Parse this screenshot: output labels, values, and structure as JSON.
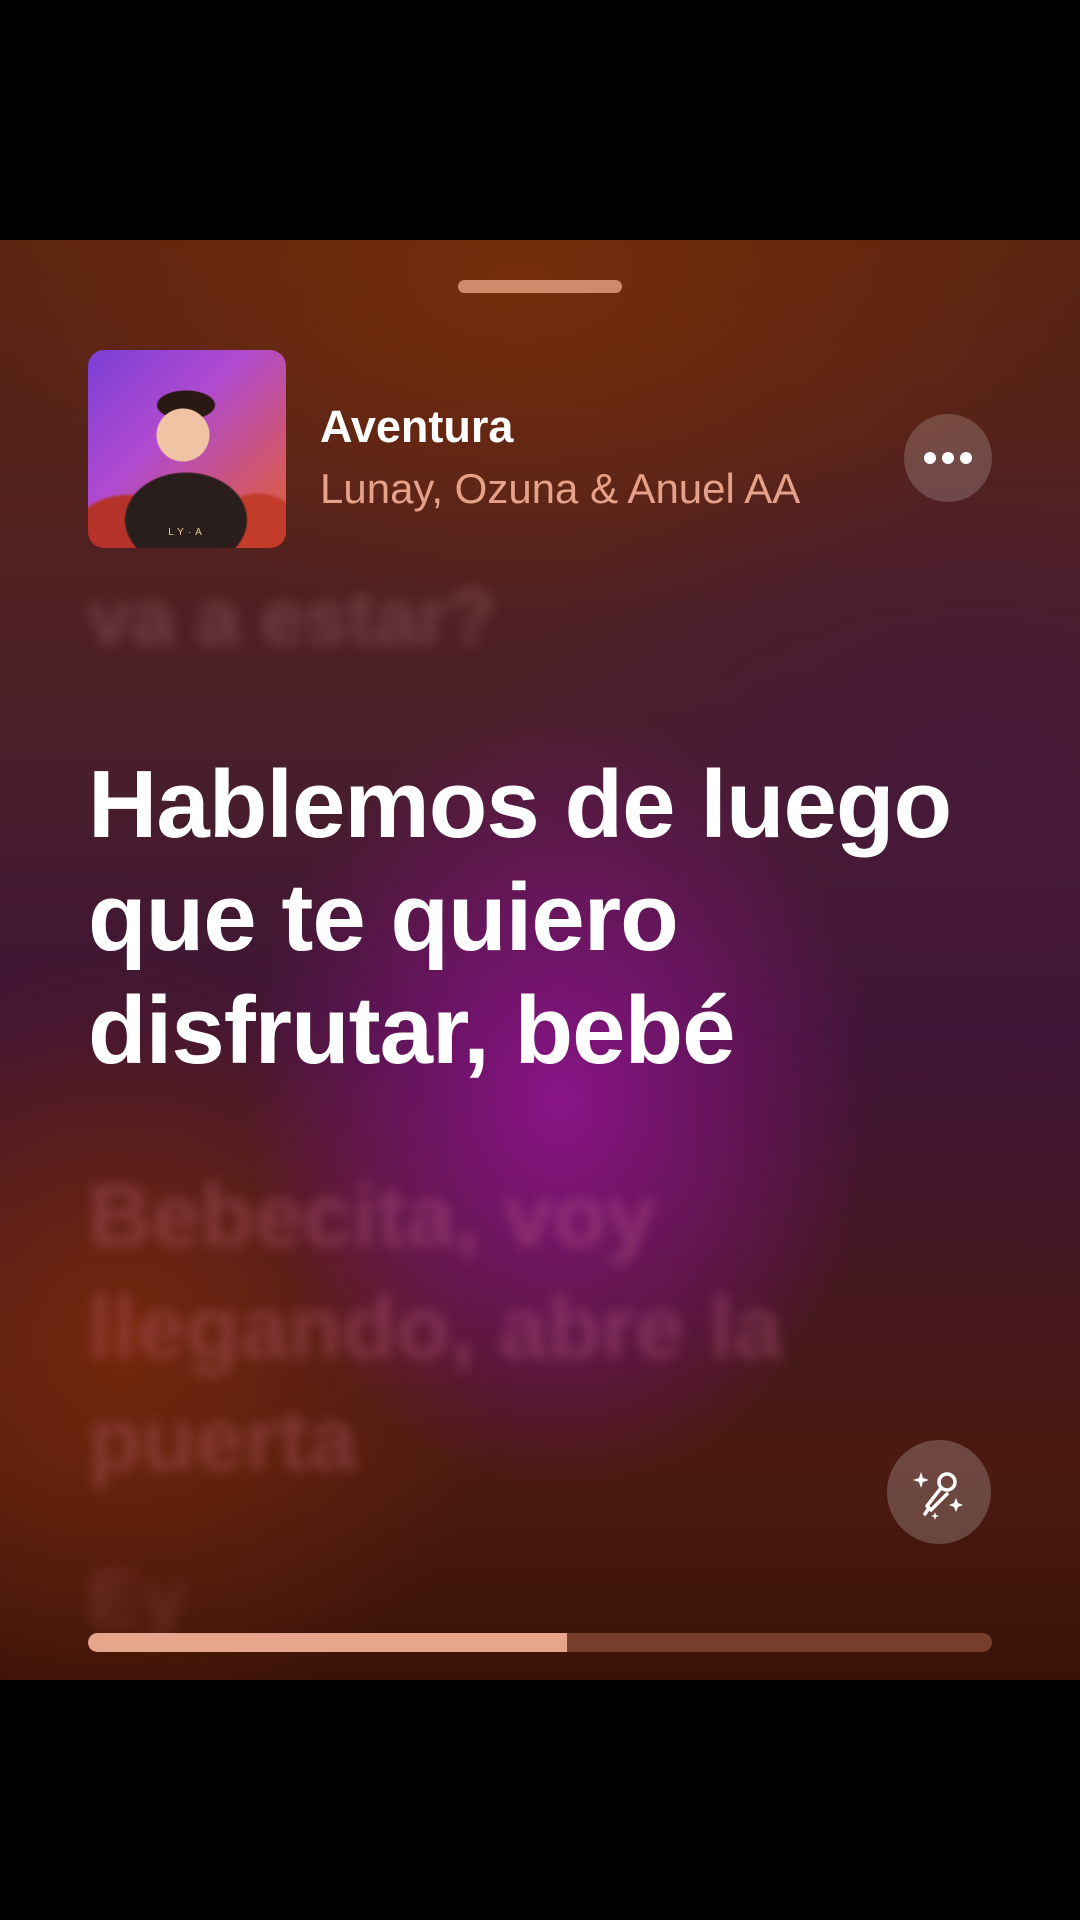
{
  "now_playing": {
    "title": "Aventura",
    "artist": "Lunay, Ozuna & Anuel AA",
    "artwork_signature": "LY·A",
    "more_icon": "ellipsis-icon"
  },
  "lyrics": {
    "previous": "va a estar?",
    "current": "Hablemos de luego que te quiero disfrutar, bebé",
    "next": "Bebecita, voy llegando, abre la puerta",
    "next2": "Ey"
  },
  "controls": {
    "sing_icon": "microphone-sparkles-icon"
  },
  "progress": {
    "fraction": 0.53
  },
  "colors": {
    "progress_fill": "#e7a58c",
    "artist_text": "#f5af96"
  }
}
